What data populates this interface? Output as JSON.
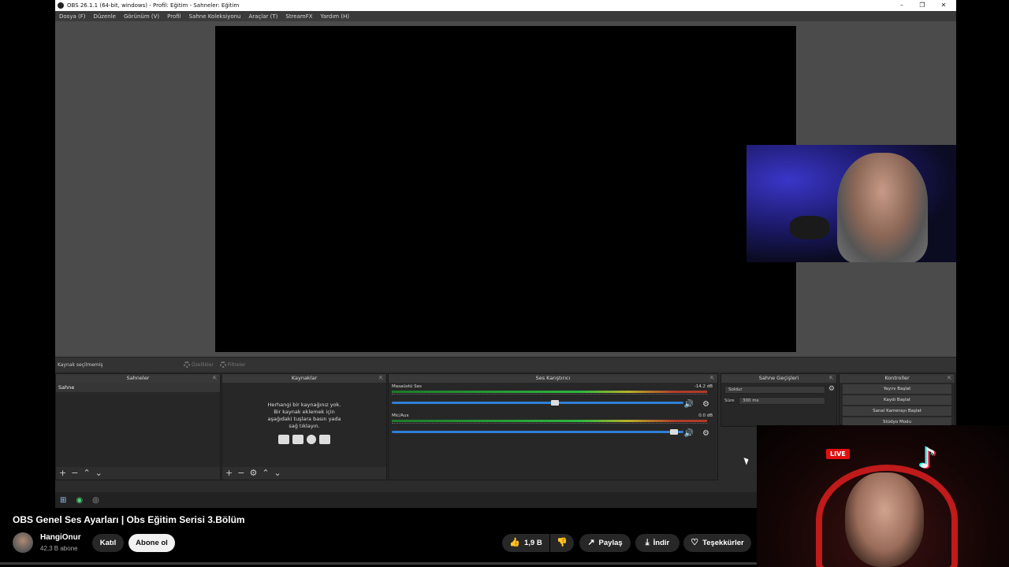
{
  "window": {
    "title": "OBS 26.1.1 (64-bit, windows) - Profil: Eğitim - Sahneler: Eğitim",
    "min": "–",
    "max": "❐",
    "close": "✕"
  },
  "menu": [
    "Dosya (F)",
    "Düzenle",
    "Görünüm (V)",
    "Profil",
    "Sahne Koleksiyonu",
    "Araçlar (T)",
    "StreamFX",
    "Yardım (H)"
  ],
  "sourcebar": {
    "label": "Kaynak seçilmemiş",
    "properties": "Özellikler",
    "filters": "Filtreler"
  },
  "scenes": {
    "title": "Sahneler",
    "items": [
      "Sahne"
    ]
  },
  "sources": {
    "title": "Kaynaklar",
    "empty_line1": "Herhangi bir kaynağınız yok.",
    "empty_line2": "Bir kaynak eklemek için",
    "empty_line3": "aşağıdaki tuşlara basın yada",
    "empty_line4": "sağ tıklayın."
  },
  "mixer": {
    "title": "Ses Karıştırıcı",
    "channels": [
      {
        "name": "Masaüstü Ses",
        "db": "-14.2 dB",
        "fader_level": 0.56
      },
      {
        "name": "Mic/Aux",
        "db": "0.0 dB",
        "fader_level": 0.98
      }
    ]
  },
  "transitions": {
    "title": "Sahne Geçişleri",
    "type": "Soldur",
    "duration_label": "Süre",
    "duration": "300 ms"
  },
  "controls": {
    "title": "Kontroller",
    "buttons": [
      "Yayını Başlat",
      "Kaydı Başlat",
      "Sanal Kamerayı Başlat",
      "Stüdyo Modu"
    ]
  },
  "overlay": {
    "live": "LIVE"
  },
  "youtube": {
    "title": "OBS Genel Ses Ayarları | Obs Eğitim Serisi 3.Bölüm",
    "channel": "HangiOnur",
    "subs": "42,3 B abone",
    "join": "Katıl",
    "subscribe": "Abone ol",
    "likes": "1,9 B",
    "share": "Paylaş",
    "download": "İndir",
    "thanks": "Teşekkürler"
  }
}
